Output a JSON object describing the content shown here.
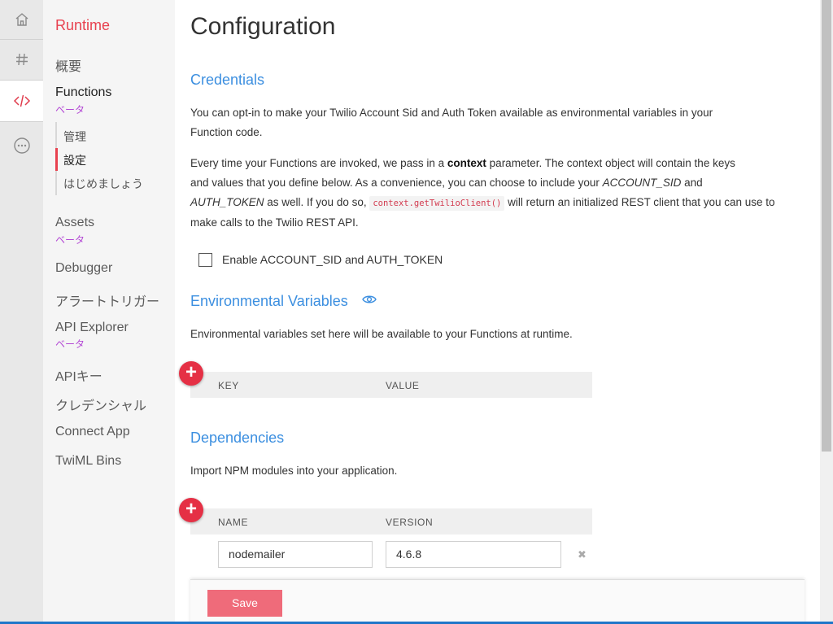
{
  "rail": {
    "items": [
      "home-icon",
      "hash-icon",
      "code-icon",
      "more-icon"
    ],
    "accent": "#e03e4e"
  },
  "nav": {
    "title": "Runtime",
    "overview": "概要",
    "functions": "Functions",
    "functions_beta": "ベータ",
    "sub": {
      "manage": "管理",
      "settings": "設定",
      "getting_started": "はじめましょう"
    },
    "assets": "Assets",
    "assets_beta": "ベータ",
    "debugger": "Debugger",
    "alarms": "アラートトリガー",
    "api_explorer": "API Explorer",
    "api_explorer_beta": "ベータ",
    "api_keys": "APIキー",
    "credentials": "クレデンシャル",
    "connect_app": "Connect App",
    "twiml_bins": "TwiML Bins"
  },
  "main": {
    "title": "Configuration",
    "credentials": {
      "heading": "Credentials",
      "p1_line1": "You can opt-in to make your Twilio Account Sid and Auth Token available as environmental variables in your",
      "p1_line2": "Function code.",
      "p2_a": "Every time your Functions are invoked, we pass in a ",
      "p2_context": "context",
      "p2_b": " parameter. The context object will contain the keys",
      "p2_c": "and values that you define below. As a convenience, you can choose to include your ",
      "p2_sid": "ACCOUNT_SID",
      "p2_and": " and",
      "p2_token": "AUTH_TOKEN",
      "p2_d": " as well. If you do so, ",
      "p2_code": "context.getTwilioClient()",
      "p2_e": " will return an initialized REST client that you can use to",
      "p2_f": "make calls to the Twilio REST API.",
      "checkbox_label": "Enable ACCOUNT_SID and AUTH_TOKEN"
    },
    "env": {
      "heading": "Environmental Variables",
      "desc": "Environmental variables set here will be available to your Functions at runtime.",
      "col_key": "KEY",
      "col_value": "VALUE"
    },
    "deps": {
      "heading": "Dependencies",
      "desc": "Import NPM modules into your application.",
      "col_name": "NAME",
      "col_version": "VERSION",
      "row_name": "nodemailer",
      "row_version": "4.6.8"
    },
    "save_label": "Save"
  }
}
